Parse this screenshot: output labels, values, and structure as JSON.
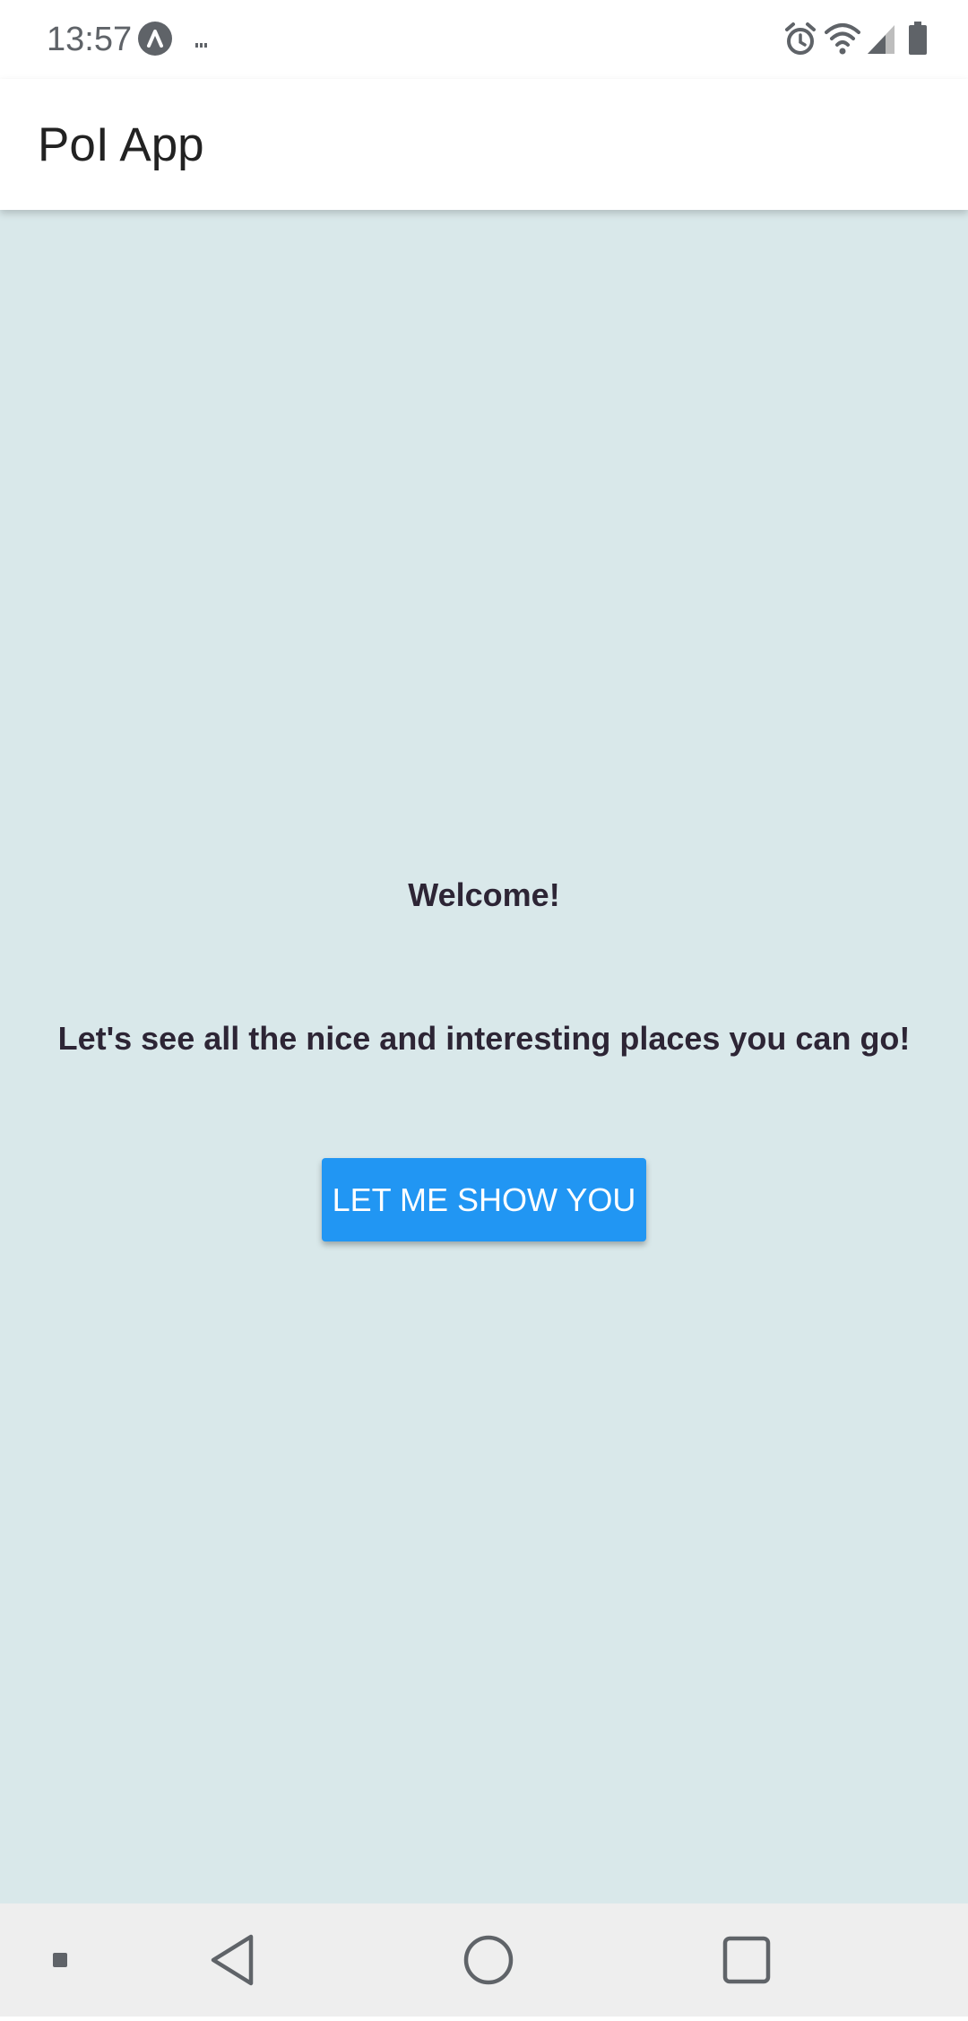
{
  "status_bar": {
    "time": "13:57",
    "icons": [
      "app-notification-icon",
      "more-notifications-icon",
      "alarm-icon",
      "wifi-icon",
      "signal-icon",
      "battery-icon"
    ]
  },
  "app_bar": {
    "title": "PoI App"
  },
  "main": {
    "welcome": "Welcome!",
    "subtitle": "Let's see all the nice and interesting places you can go!",
    "button_label": "LET ME SHOW YOU"
  },
  "nav_bar": {
    "icons": [
      "small-square-icon",
      "back-icon",
      "home-icon",
      "recents-icon"
    ]
  },
  "colors": {
    "background": "#d9e8ea",
    "button": "#2196f3",
    "text": "#2d2535",
    "nav_bar": "#eeeeee"
  }
}
